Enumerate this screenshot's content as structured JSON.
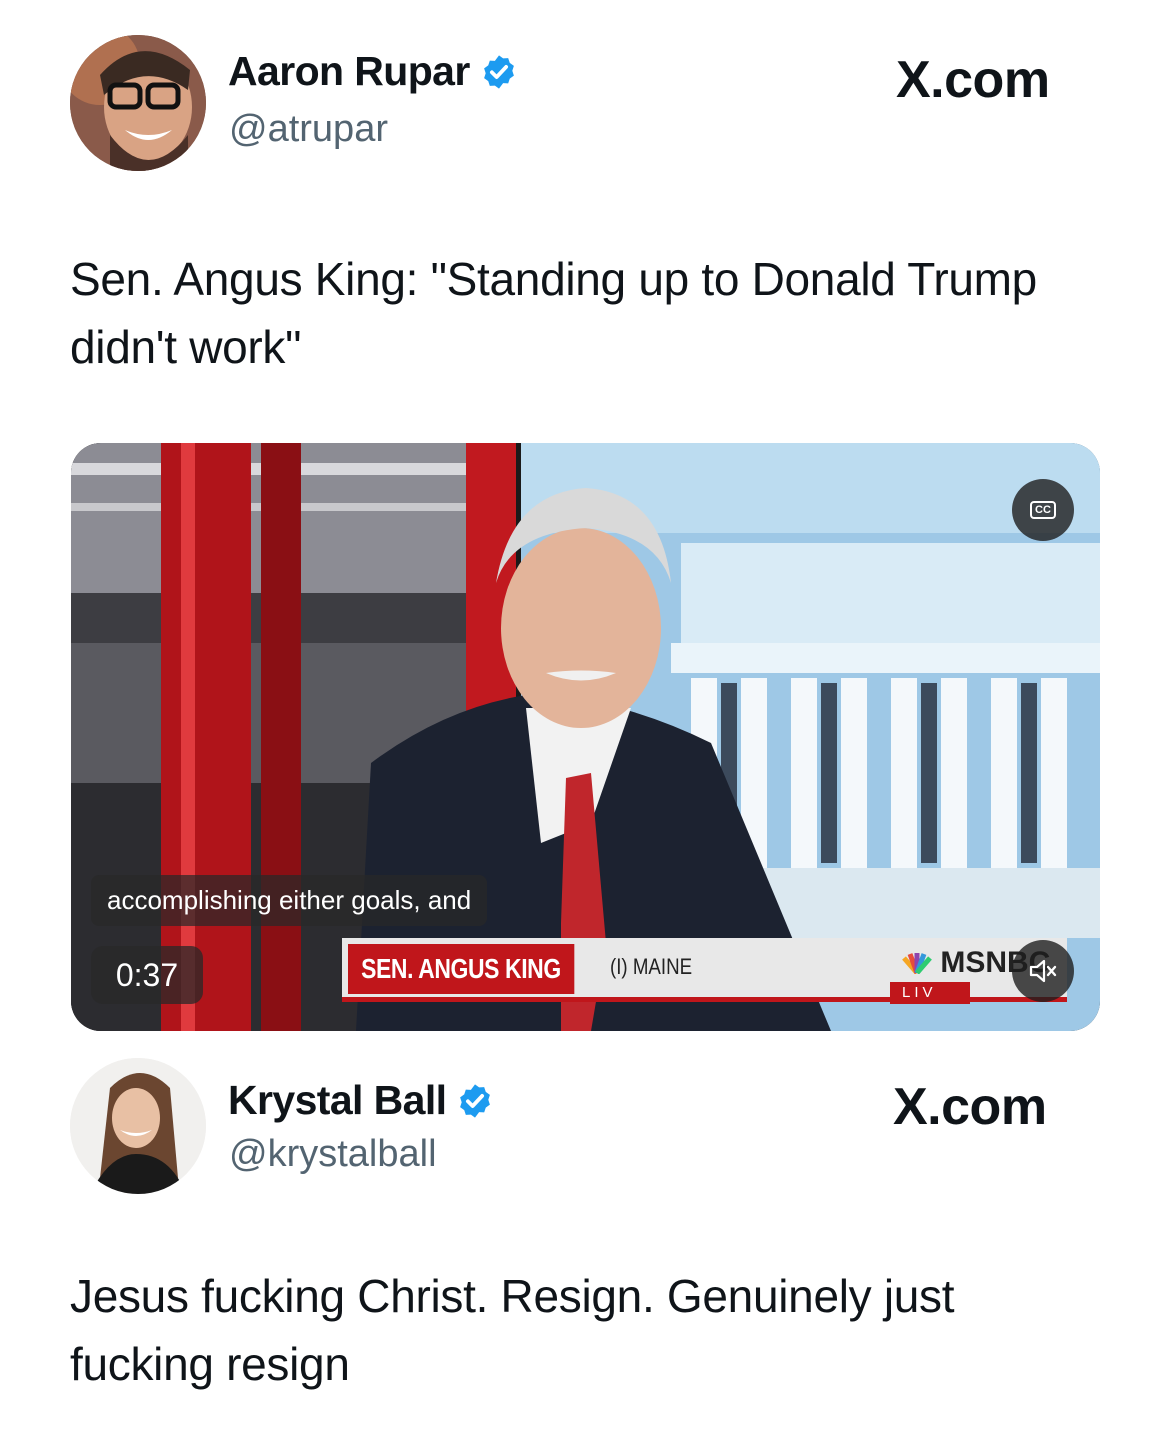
{
  "posts": [
    {
      "author_name": "Aaron Rupar",
      "handle": "@atrupar",
      "source_label": "X.com",
      "text": "Sen. Angus King: \"Standing up to Donald Trump didn't work\"",
      "verified": true,
      "video": {
        "caption": "accomplishing either goals, and",
        "elapsed": "0:37",
        "lower_third_name": "SEN. ANGUS KING",
        "lower_third_sub": "(I) MAINE",
        "network": "MSNBC",
        "live_label": "LIV",
        "cc_label": "CC"
      }
    },
    {
      "author_name": "Krystal Ball",
      "handle": "@krystalball",
      "source_label": "X.com",
      "text": "Jesus fucking Christ. Resign. Genuinely just fucking resign",
      "verified": true
    }
  ],
  "colors": {
    "verified_blue": "#1d9bf0",
    "handle_gray": "#536471",
    "news_red": "#c0161b"
  },
  "icons": [
    "verified-badge-icon",
    "closed-captions-icon",
    "muted-speaker-icon",
    "peacock-logo-icon"
  ]
}
